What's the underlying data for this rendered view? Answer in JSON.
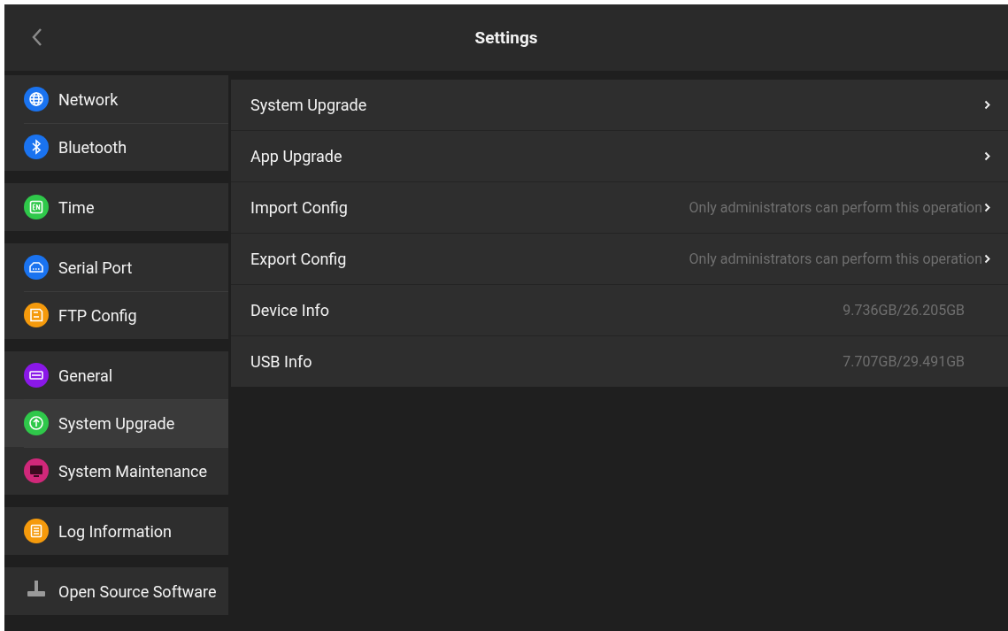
{
  "header": {
    "title": "Settings"
  },
  "sidebar": {
    "groups": [
      {
        "items": [
          {
            "label": "Network",
            "kind": "globe",
            "color": "#1a73f0",
            "selected": false
          },
          {
            "label": "Bluetooth",
            "kind": "bluetooth",
            "color": "#1a73f0",
            "selected": false
          }
        ]
      },
      {
        "items": [
          {
            "label": "Time",
            "kind": "en",
            "color": "#2fc84a",
            "selected": false
          }
        ]
      },
      {
        "items": [
          {
            "label": "Serial Port",
            "kind": "port",
            "color": "#1a73f0",
            "selected": false
          },
          {
            "label": "FTP Config",
            "kind": "save",
            "color": "#f59a0c",
            "selected": false
          }
        ]
      },
      {
        "items": [
          {
            "label": "General",
            "kind": "card",
            "color": "#8a18e8",
            "selected": false
          },
          {
            "label": "System Upgrade",
            "kind": "upload",
            "color": "#2fc84a",
            "selected": true
          },
          {
            "label": "System Maintenance",
            "kind": "monitor",
            "color": "#d0287a",
            "selected": false
          }
        ]
      },
      {
        "items": [
          {
            "label": "Log Information",
            "kind": "list",
            "color": "#f59a0c",
            "selected": false
          }
        ]
      },
      {
        "items": [
          {
            "label": "Open Source Software",
            "kind": "plug",
            "color": "#9a9a9a",
            "selected": false
          }
        ]
      }
    ]
  },
  "rows": [
    {
      "label": "System Upgrade",
      "chevron": true
    },
    {
      "label": "App Upgrade",
      "chevron": true
    },
    {
      "label": "Import Config",
      "value": "Only administrators can perform this operation",
      "chevron": true
    },
    {
      "label": "Export Config",
      "value": "Only administrators can perform this operation",
      "chevron": true
    },
    {
      "label": "Device Info",
      "value": "9.736GB/26.205GB",
      "chevron": false
    },
    {
      "label": "USB Info",
      "value": "7.707GB/29.491GB",
      "chevron": false
    }
  ]
}
